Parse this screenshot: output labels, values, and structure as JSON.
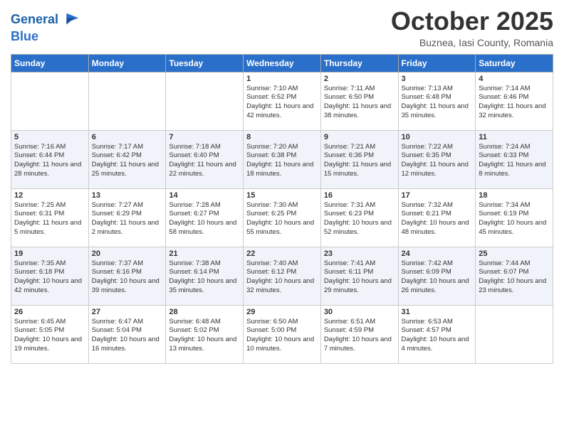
{
  "header": {
    "logo_line1": "General",
    "logo_line2": "Blue",
    "month": "October 2025",
    "location": "Buznea, Iasi County, Romania"
  },
  "weekdays": [
    "Sunday",
    "Monday",
    "Tuesday",
    "Wednesday",
    "Thursday",
    "Friday",
    "Saturday"
  ],
  "weeks": [
    [
      {
        "day": "",
        "info": ""
      },
      {
        "day": "",
        "info": ""
      },
      {
        "day": "",
        "info": ""
      },
      {
        "day": "1",
        "info": "Sunrise: 7:10 AM\nSunset: 6:52 PM\nDaylight: 11 hours and 42 minutes."
      },
      {
        "day": "2",
        "info": "Sunrise: 7:11 AM\nSunset: 6:50 PM\nDaylight: 11 hours and 38 minutes."
      },
      {
        "day": "3",
        "info": "Sunrise: 7:13 AM\nSunset: 6:48 PM\nDaylight: 11 hours and 35 minutes."
      },
      {
        "day": "4",
        "info": "Sunrise: 7:14 AM\nSunset: 6:46 PM\nDaylight: 11 hours and 32 minutes."
      }
    ],
    [
      {
        "day": "5",
        "info": "Sunrise: 7:16 AM\nSunset: 6:44 PM\nDaylight: 11 hours and 28 minutes."
      },
      {
        "day": "6",
        "info": "Sunrise: 7:17 AM\nSunset: 6:42 PM\nDaylight: 11 hours and 25 minutes."
      },
      {
        "day": "7",
        "info": "Sunrise: 7:18 AM\nSunset: 6:40 PM\nDaylight: 11 hours and 22 minutes."
      },
      {
        "day": "8",
        "info": "Sunrise: 7:20 AM\nSunset: 6:38 PM\nDaylight: 11 hours and 18 minutes."
      },
      {
        "day": "9",
        "info": "Sunrise: 7:21 AM\nSunset: 6:36 PM\nDaylight: 11 hours and 15 minutes."
      },
      {
        "day": "10",
        "info": "Sunrise: 7:22 AM\nSunset: 6:35 PM\nDaylight: 11 hours and 12 minutes."
      },
      {
        "day": "11",
        "info": "Sunrise: 7:24 AM\nSunset: 6:33 PM\nDaylight: 11 hours and 8 minutes."
      }
    ],
    [
      {
        "day": "12",
        "info": "Sunrise: 7:25 AM\nSunset: 6:31 PM\nDaylight: 11 hours and 5 minutes."
      },
      {
        "day": "13",
        "info": "Sunrise: 7:27 AM\nSunset: 6:29 PM\nDaylight: 11 hours and 2 minutes."
      },
      {
        "day": "14",
        "info": "Sunrise: 7:28 AM\nSunset: 6:27 PM\nDaylight: 10 hours and 58 minutes."
      },
      {
        "day": "15",
        "info": "Sunrise: 7:30 AM\nSunset: 6:25 PM\nDaylight: 10 hours and 55 minutes."
      },
      {
        "day": "16",
        "info": "Sunrise: 7:31 AM\nSunset: 6:23 PM\nDaylight: 10 hours and 52 minutes."
      },
      {
        "day": "17",
        "info": "Sunrise: 7:32 AM\nSunset: 6:21 PM\nDaylight: 10 hours and 48 minutes."
      },
      {
        "day": "18",
        "info": "Sunrise: 7:34 AM\nSunset: 6:19 PM\nDaylight: 10 hours and 45 minutes."
      }
    ],
    [
      {
        "day": "19",
        "info": "Sunrise: 7:35 AM\nSunset: 6:18 PM\nDaylight: 10 hours and 42 minutes."
      },
      {
        "day": "20",
        "info": "Sunrise: 7:37 AM\nSunset: 6:16 PM\nDaylight: 10 hours and 39 minutes."
      },
      {
        "day": "21",
        "info": "Sunrise: 7:38 AM\nSunset: 6:14 PM\nDaylight: 10 hours and 35 minutes."
      },
      {
        "day": "22",
        "info": "Sunrise: 7:40 AM\nSunset: 6:12 PM\nDaylight: 10 hours and 32 minutes."
      },
      {
        "day": "23",
        "info": "Sunrise: 7:41 AM\nSunset: 6:11 PM\nDaylight: 10 hours and 29 minutes."
      },
      {
        "day": "24",
        "info": "Sunrise: 7:42 AM\nSunset: 6:09 PM\nDaylight: 10 hours and 26 minutes."
      },
      {
        "day": "25",
        "info": "Sunrise: 7:44 AM\nSunset: 6:07 PM\nDaylight: 10 hours and 23 minutes."
      }
    ],
    [
      {
        "day": "26",
        "info": "Sunrise: 6:45 AM\nSunset: 5:05 PM\nDaylight: 10 hours and 19 minutes."
      },
      {
        "day": "27",
        "info": "Sunrise: 6:47 AM\nSunset: 5:04 PM\nDaylight: 10 hours and 16 minutes."
      },
      {
        "day": "28",
        "info": "Sunrise: 6:48 AM\nSunset: 5:02 PM\nDaylight: 10 hours and 13 minutes."
      },
      {
        "day": "29",
        "info": "Sunrise: 6:50 AM\nSunset: 5:00 PM\nDaylight: 10 hours and 10 minutes."
      },
      {
        "day": "30",
        "info": "Sunrise: 6:51 AM\nSunset: 4:59 PM\nDaylight: 10 hours and 7 minutes."
      },
      {
        "day": "31",
        "info": "Sunrise: 6:53 AM\nSunset: 4:57 PM\nDaylight: 10 hours and 4 minutes."
      },
      {
        "day": "",
        "info": ""
      }
    ]
  ]
}
